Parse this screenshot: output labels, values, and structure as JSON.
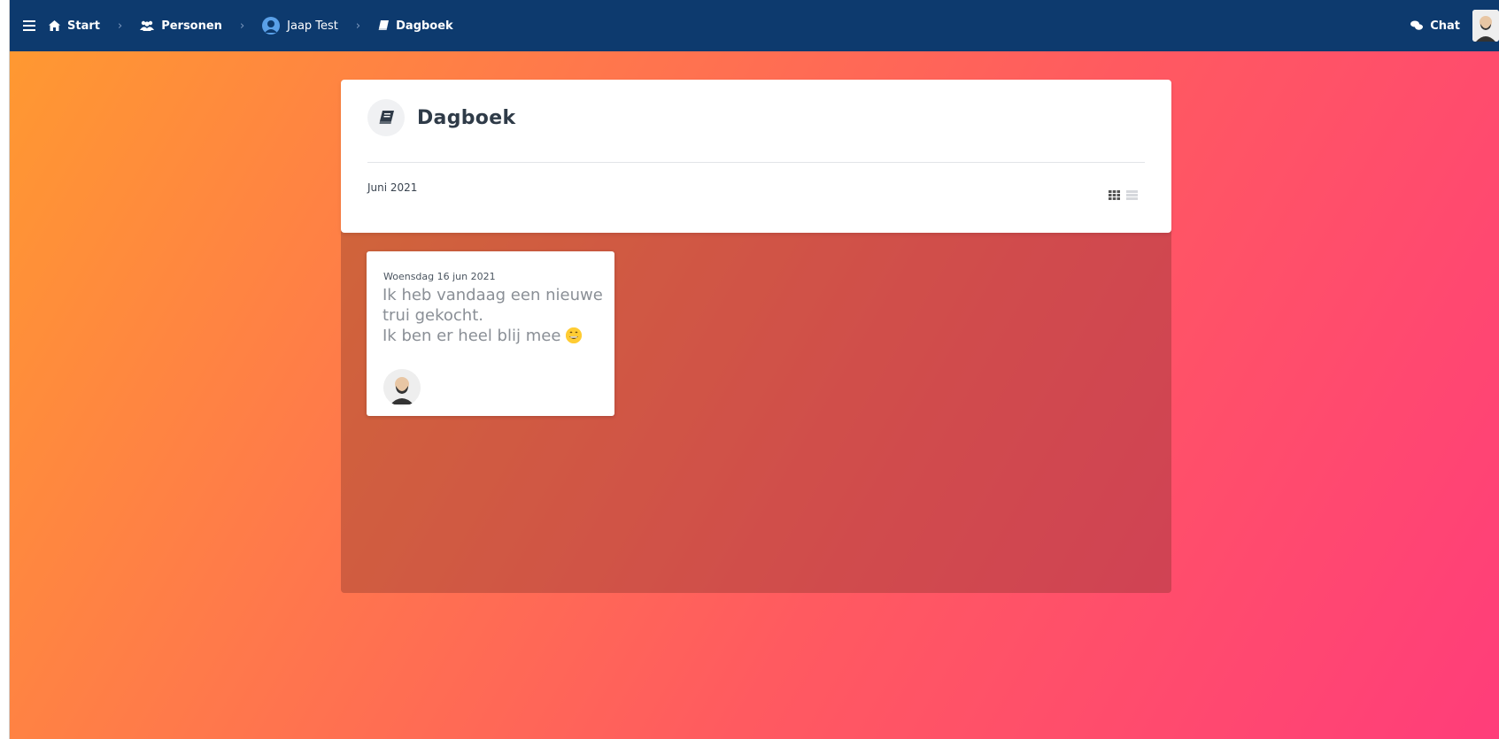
{
  "topbar": {
    "menu_icon": "hamburger-icon",
    "breadcrumbs": [
      {
        "label": "Start",
        "icon": "home-icon"
      },
      {
        "label": "Personen",
        "icon": "users-icon"
      },
      {
        "label": "Jaap Test",
        "icon": "user-circle-icon"
      },
      {
        "label": "Dagboek",
        "icon": "book-icon"
      }
    ],
    "chat_label": "Chat",
    "chat_icon": "chat-bubbles-icon"
  },
  "header": {
    "title": "Dagboek",
    "month": "Juni 2021"
  },
  "entries": [
    {
      "date": "Woensdag 16 jun 2021",
      "line1": "Ik heb vandaag een nieuwe trui gekocht.",
      "line2": "Ik ben er heel blij mee",
      "emoji": "grinning-face"
    }
  ],
  "colors": {
    "topbar": "#0d3a6e",
    "gradient_start": "#ff9a30",
    "gradient_end": "#ff3d7a"
  }
}
